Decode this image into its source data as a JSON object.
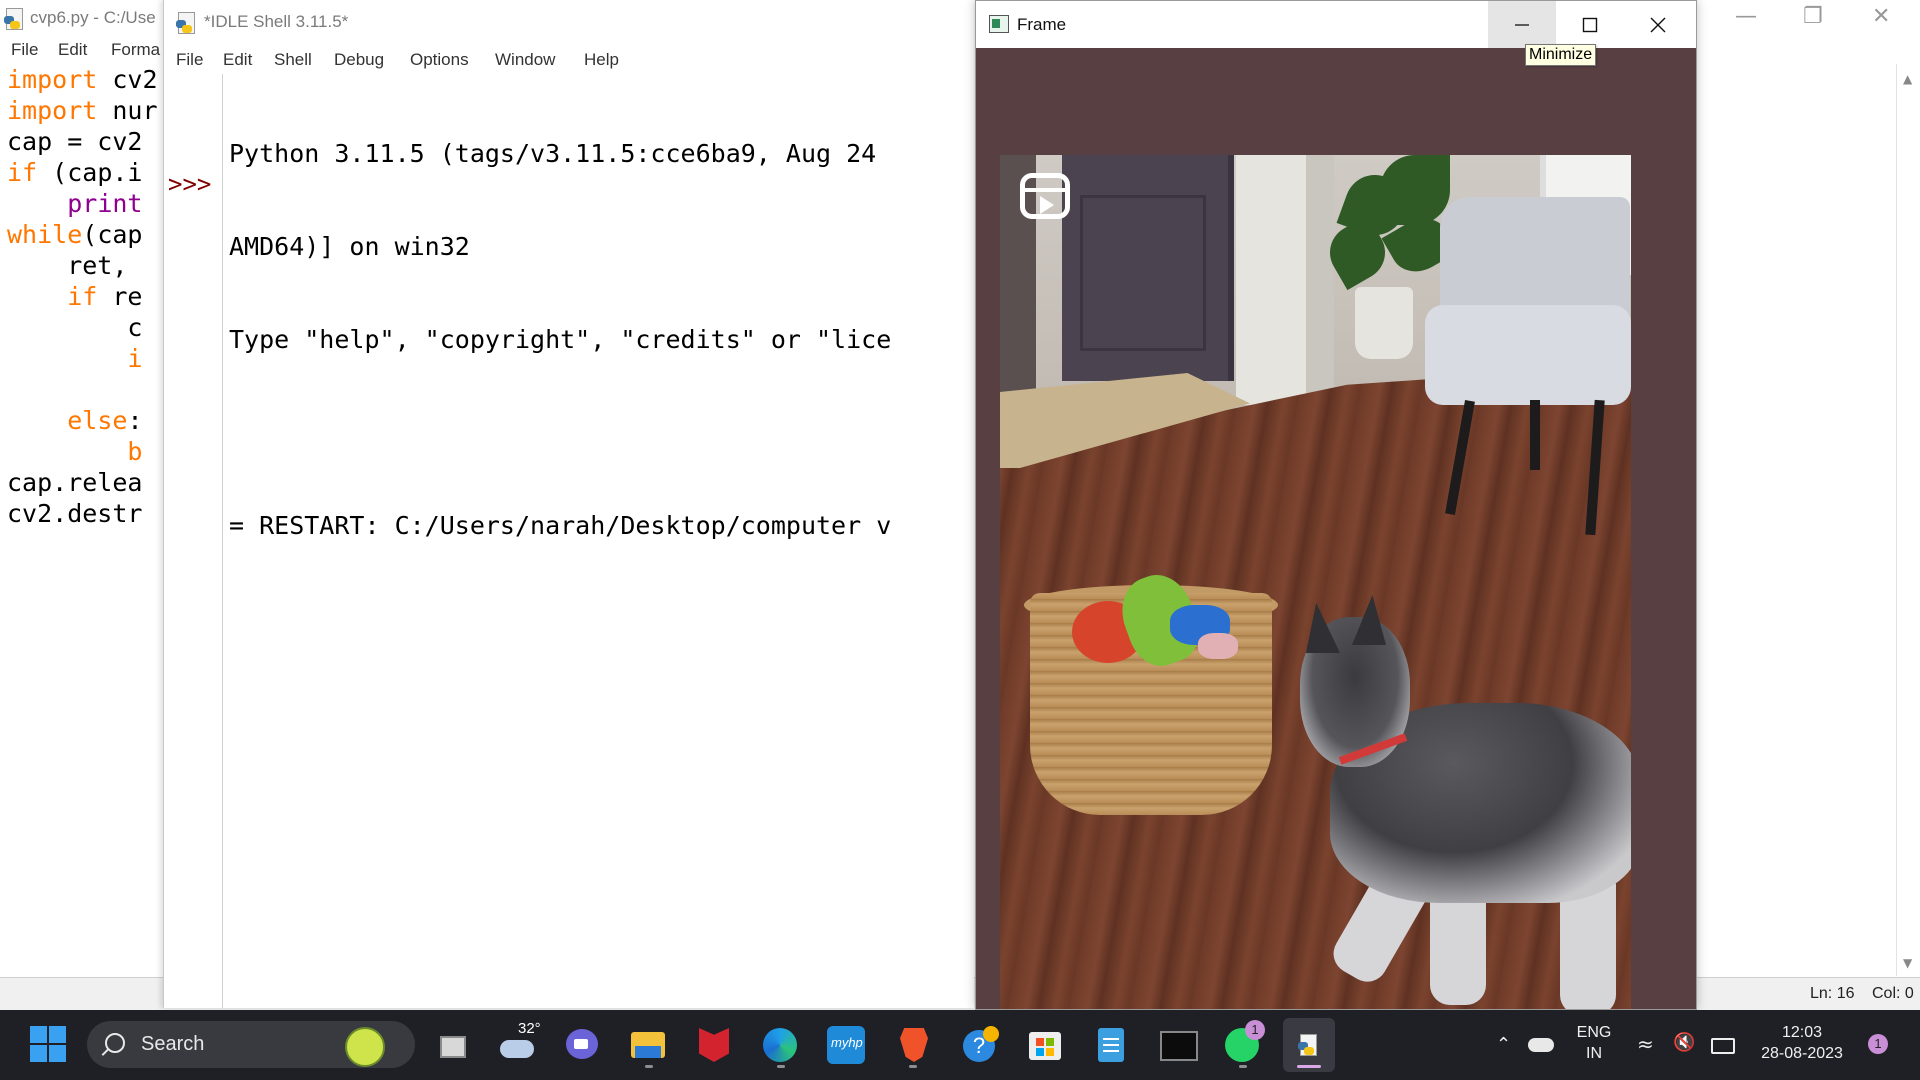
{
  "editor": {
    "title": "cvp6.py - C:/Use",
    "menu": [
      "File",
      "Edit",
      "Forma"
    ],
    "code_lines": [
      [
        {
          "t": "import",
          "c": "kw"
        },
        {
          "t": " cv2",
          "c": ""
        }
      ],
      [
        {
          "t": "import",
          "c": "kw"
        },
        {
          "t": " nur",
          "c": ""
        }
      ],
      [
        {
          "t": "cap = cv2",
          "c": ""
        }
      ],
      [
        {
          "t": "if",
          "c": "kw"
        },
        {
          "t": " (cap.i",
          "c": ""
        }
      ],
      [
        {
          "t": "    ",
          "c": ""
        },
        {
          "t": "print",
          "c": "bi"
        }
      ],
      [
        {
          "t": "while",
          "c": "kw"
        },
        {
          "t": "(cap",
          "c": ""
        }
      ],
      [
        {
          "t": "    ret, ",
          "c": ""
        }
      ],
      [
        {
          "t": "    ",
          "c": ""
        },
        {
          "t": "if",
          "c": "kw"
        },
        {
          "t": " re",
          "c": ""
        }
      ],
      [
        {
          "t": "        c",
          "c": ""
        }
      ],
      [
        {
          "t": "        ",
          "c": ""
        },
        {
          "t": "i",
          "c": "kw"
        }
      ],
      [
        {
          "t": "",
          "c": ""
        }
      ],
      [
        {
          "t": "    ",
          "c": ""
        },
        {
          "t": "else",
          "c": "kw"
        },
        {
          "t": ":",
          "c": ""
        }
      ],
      [
        {
          "t": "        ",
          "c": ""
        },
        {
          "t": "b",
          "c": "kw"
        }
      ],
      [
        {
          "t": "cap.relea",
          "c": ""
        }
      ],
      [
        {
          "t": "cv2.destr",
          "c": ""
        }
      ]
    ],
    "status": {
      "line": "Ln: 16",
      "col": "Col: 0"
    }
  },
  "shell": {
    "title": "*IDLE Shell 3.11.5*",
    "menu": [
      "File",
      "Edit",
      "Shell",
      "Debug",
      "Options",
      "Window",
      "Help"
    ],
    "prompt": ">>>",
    "output_lines": [
      "Python 3.11.5 (tags/v3.11.5:cce6ba9, Aug 24",
      "AMD64)] on win32",
      "Type \"help\", \"copyright\", \"credits\" or \"lice",
      "",
      "= RESTART: C:/Users/narah/Desktop/computer v"
    ]
  },
  "frame": {
    "title": "Frame",
    "tooltip": "Minimize"
  },
  "taskbar": {
    "search_label": "Search",
    "weather_temp": "32°",
    "language": [
      "ENG",
      "IN"
    ],
    "time": "12:03",
    "date": "28-08-2023",
    "whatsapp_badge": "1",
    "notification_badge": "1",
    "icons": [
      "start-icon",
      "search-icon",
      "task-view-icon",
      "weather-icon",
      "teams-chat-icon",
      "file-explorer-icon",
      "mcafee-icon",
      "edge-icon",
      "myhp-icon",
      "brave-icon",
      "help-icon",
      "store-icon",
      "notepad-icon",
      "terminal-icon",
      "whatsapp-icon",
      "idle-icon"
    ],
    "colors": {
      "taskbar_bg": "#1f1f26",
      "accent": "#3aa0f0"
    }
  }
}
